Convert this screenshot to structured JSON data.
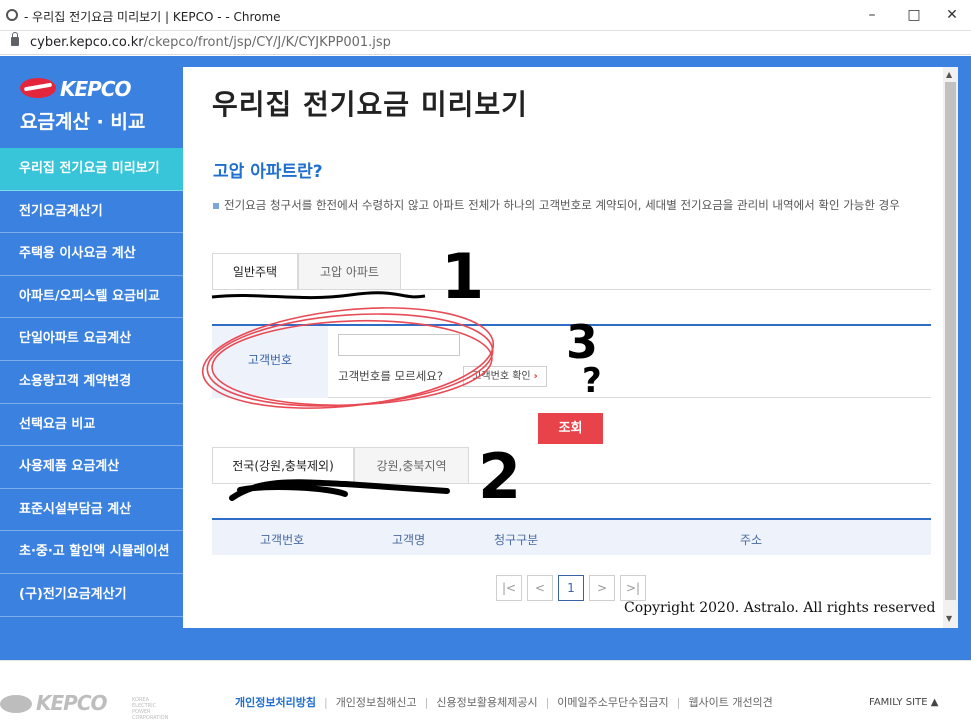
{
  "window": {
    "title": "- 우리집 전기요금 미리보기 | KEPCO - - Chrome",
    "url_host": "cyber.kepco.co.kr",
    "url_path": "/ckepco/front/jsp/CY/J/K/CYJKPP001.jsp"
  },
  "sidebar": {
    "logo_text": "KEPCO",
    "section_title": "요금계산 · 비교",
    "items": [
      {
        "label": "우리집 전기요금 미리보기"
      },
      {
        "label": "전기요금계산기"
      },
      {
        "label": "주택용 이사요금 계산"
      },
      {
        "label": "아파트/오피스텔 요금비교"
      },
      {
        "label": "단일아파트 요금계산"
      },
      {
        "label": "소용량고객 계약변경"
      },
      {
        "label": "선택요금 비교"
      },
      {
        "label": "사용제품 요금계산"
      },
      {
        "label": "표준시설부담금 계산"
      },
      {
        "label": "초·중·고 할인액 시뮬레이션"
      },
      {
        "label": "(구)전기요금계산기"
      }
    ]
  },
  "main": {
    "page_title": "우리집 전기요금 미리보기",
    "sub_title": "고압 아파트란?",
    "description": "전기요금 청구서를 한전에서 수령하지 않고 아파트 전체가 하나의 고객번호로 계약되어, 세대별 전기요금을 관리비 내역에서 확인 가능한 경우",
    "tabs": [
      {
        "label": "일반주택"
      },
      {
        "label": "고압 아파트"
      }
    ],
    "form": {
      "label": "고객번호",
      "input_value": "",
      "forgot_text": "고객번호를 모르세요?",
      "confirm_button": "고객번호 확인"
    },
    "search_button": "조회",
    "region_tabs": [
      {
        "label": "전국(강원,충북제외)"
      },
      {
        "label": "강원,충북지역"
      }
    ],
    "table_headers": [
      "고객번호",
      "고객명",
      "청구구분",
      "주소"
    ],
    "pagination": {
      "first": "|<",
      "prev": "<",
      "current": "1",
      "next": ">",
      "last": ">|"
    },
    "copyright": "Copyright 2020. Astralo. All rights reserved"
  },
  "annotations": [
    "1",
    "2",
    "3",
    "?"
  ],
  "footer": {
    "logo_text": "KEPCO",
    "logo_subtext": "KOREA ELECTRIC POWER CORPORATION",
    "links": [
      {
        "label": "개인정보처리방침"
      },
      {
        "label": "개인정보침해신고"
      },
      {
        "label": "신용정보활용체제공시"
      },
      {
        "label": "이메일주소무단수집금지"
      },
      {
        "label": "웹사이트 개선의견"
      }
    ],
    "family_site": "FAMILY SITE"
  },
  "colors": {
    "page_blue": "#3b82e0",
    "active_menu": "#39c5d9",
    "accent_red": "#e8434a",
    "title_blue": "#1f6fce"
  }
}
